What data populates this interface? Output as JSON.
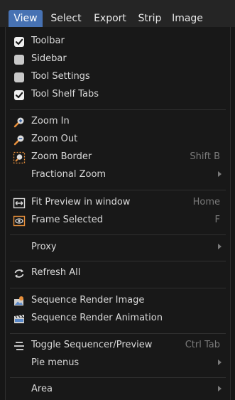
{
  "menubar": {
    "tabs": [
      {
        "label": "View",
        "active": true
      },
      {
        "label": "Select"
      },
      {
        "label": "Export"
      },
      {
        "label": "Strip"
      },
      {
        "label": "Image"
      }
    ]
  },
  "colors": {
    "accent": "#4772b3",
    "background": "#181818",
    "shortcut": "#7a7a7a",
    "icon_orange": "#e9903b"
  },
  "menu": {
    "toggles": [
      {
        "label": "Toolbar",
        "checked": true
      },
      {
        "label": "Sidebar",
        "checked": false
      },
      {
        "label": "Tool Settings",
        "checked": false
      },
      {
        "label": "Tool Shelf Tabs",
        "checked": true
      }
    ],
    "zoom_in": {
      "label": "Zoom In",
      "icon": "zoom-in-icon"
    },
    "zoom_out": {
      "label": "Zoom Out",
      "icon": "zoom-out-icon"
    },
    "zoom_border": {
      "label": "Zoom Border",
      "shortcut": "Shift B",
      "icon": "zoom-border-icon"
    },
    "fractional_zoom": {
      "label": "Fractional Zoom",
      "submenu": true
    },
    "fit_preview": {
      "label": "Fit Preview in window",
      "shortcut": "Home",
      "icon": "fit-preview-icon"
    },
    "frame_selected": {
      "label": "Frame Selected",
      "shortcut": "F",
      "icon": "frame-selected-icon"
    },
    "proxy": {
      "label": "Proxy",
      "submenu": true
    },
    "refresh_all": {
      "label": "Refresh All",
      "icon": "refresh-icon"
    },
    "render_image": {
      "label": "Sequence Render Image",
      "icon": "render-image-icon"
    },
    "render_animation": {
      "label": "Sequence Render Animation",
      "icon": "render-animation-icon"
    },
    "toggle_sequencer": {
      "label": "Toggle Sequencer/Preview",
      "shortcut": "Ctrl Tab",
      "icon": "toggle-sequencer-icon"
    },
    "pie_menus": {
      "label": "Pie menus",
      "submenu": true
    },
    "area": {
      "label": "Area",
      "submenu": true
    }
  }
}
